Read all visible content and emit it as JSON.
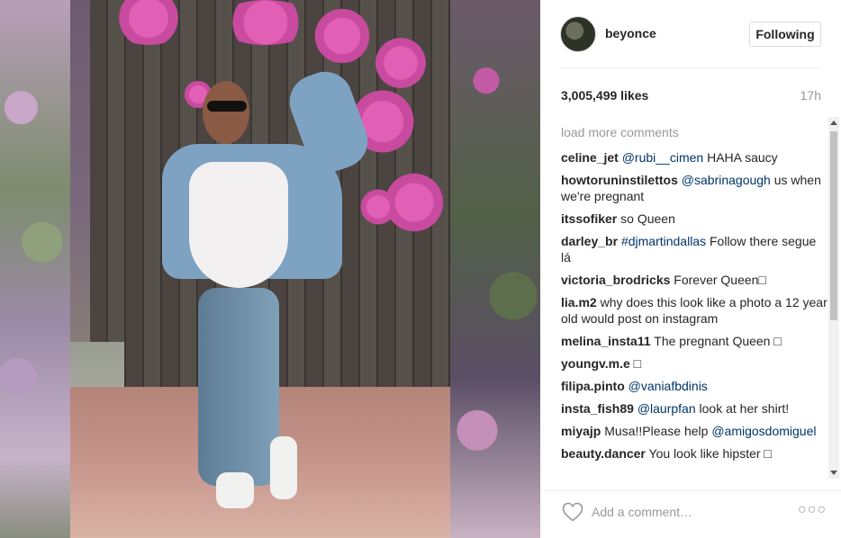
{
  "post": {
    "image_alt": "",
    "username": "beyonce",
    "follow_button": "Following",
    "likes": "3,005,499 likes",
    "time_ago": "17h",
    "load_more": "load more comments",
    "comments": [
      {
        "user": "celine_jet",
        "mention": "@rubi__cimen",
        "text": " HAHA saucy"
      },
      {
        "user": "howtoruninstilettos",
        "mention": "@sabrinagough",
        "text": " us when we're pregnant"
      },
      {
        "user": "itssofiker",
        "mention": "",
        "text": " so Queen"
      },
      {
        "user": "darley_br",
        "mention": "#djmartindallas",
        "text": " Follow there segue lá"
      },
      {
        "user": "victoria_brodricks",
        "mention": "",
        "text": " Forever Queen□"
      },
      {
        "user": "lia.m2",
        "mention": "",
        "text": " why does this look like a photo a 12 year old would post on instagram"
      },
      {
        "user": "melina_insta11",
        "mention": "",
        "text": " The pregnant Queen □"
      },
      {
        "user": "youngv.m.e",
        "mention": "",
        "text": " □"
      },
      {
        "user": "filipa.pinto",
        "mention": "@vaniafbdinis",
        "text": ""
      },
      {
        "user": "insta_fish89",
        "mention": "@laurpfan",
        "text": " look at her shirt!"
      },
      {
        "user": "miyajp",
        "mention": "",
        "text": " Musa!!Please help ",
        "mention2": "@amigosdomiguel"
      },
      {
        "user": "beauty.dancer",
        "mention": "",
        "text": " You look like hipster □"
      }
    ],
    "add_comment_placeholder": "Add a comment…",
    "icons": {
      "like": "heart-outline-icon",
      "more": "ellipsis-icon"
    }
  }
}
